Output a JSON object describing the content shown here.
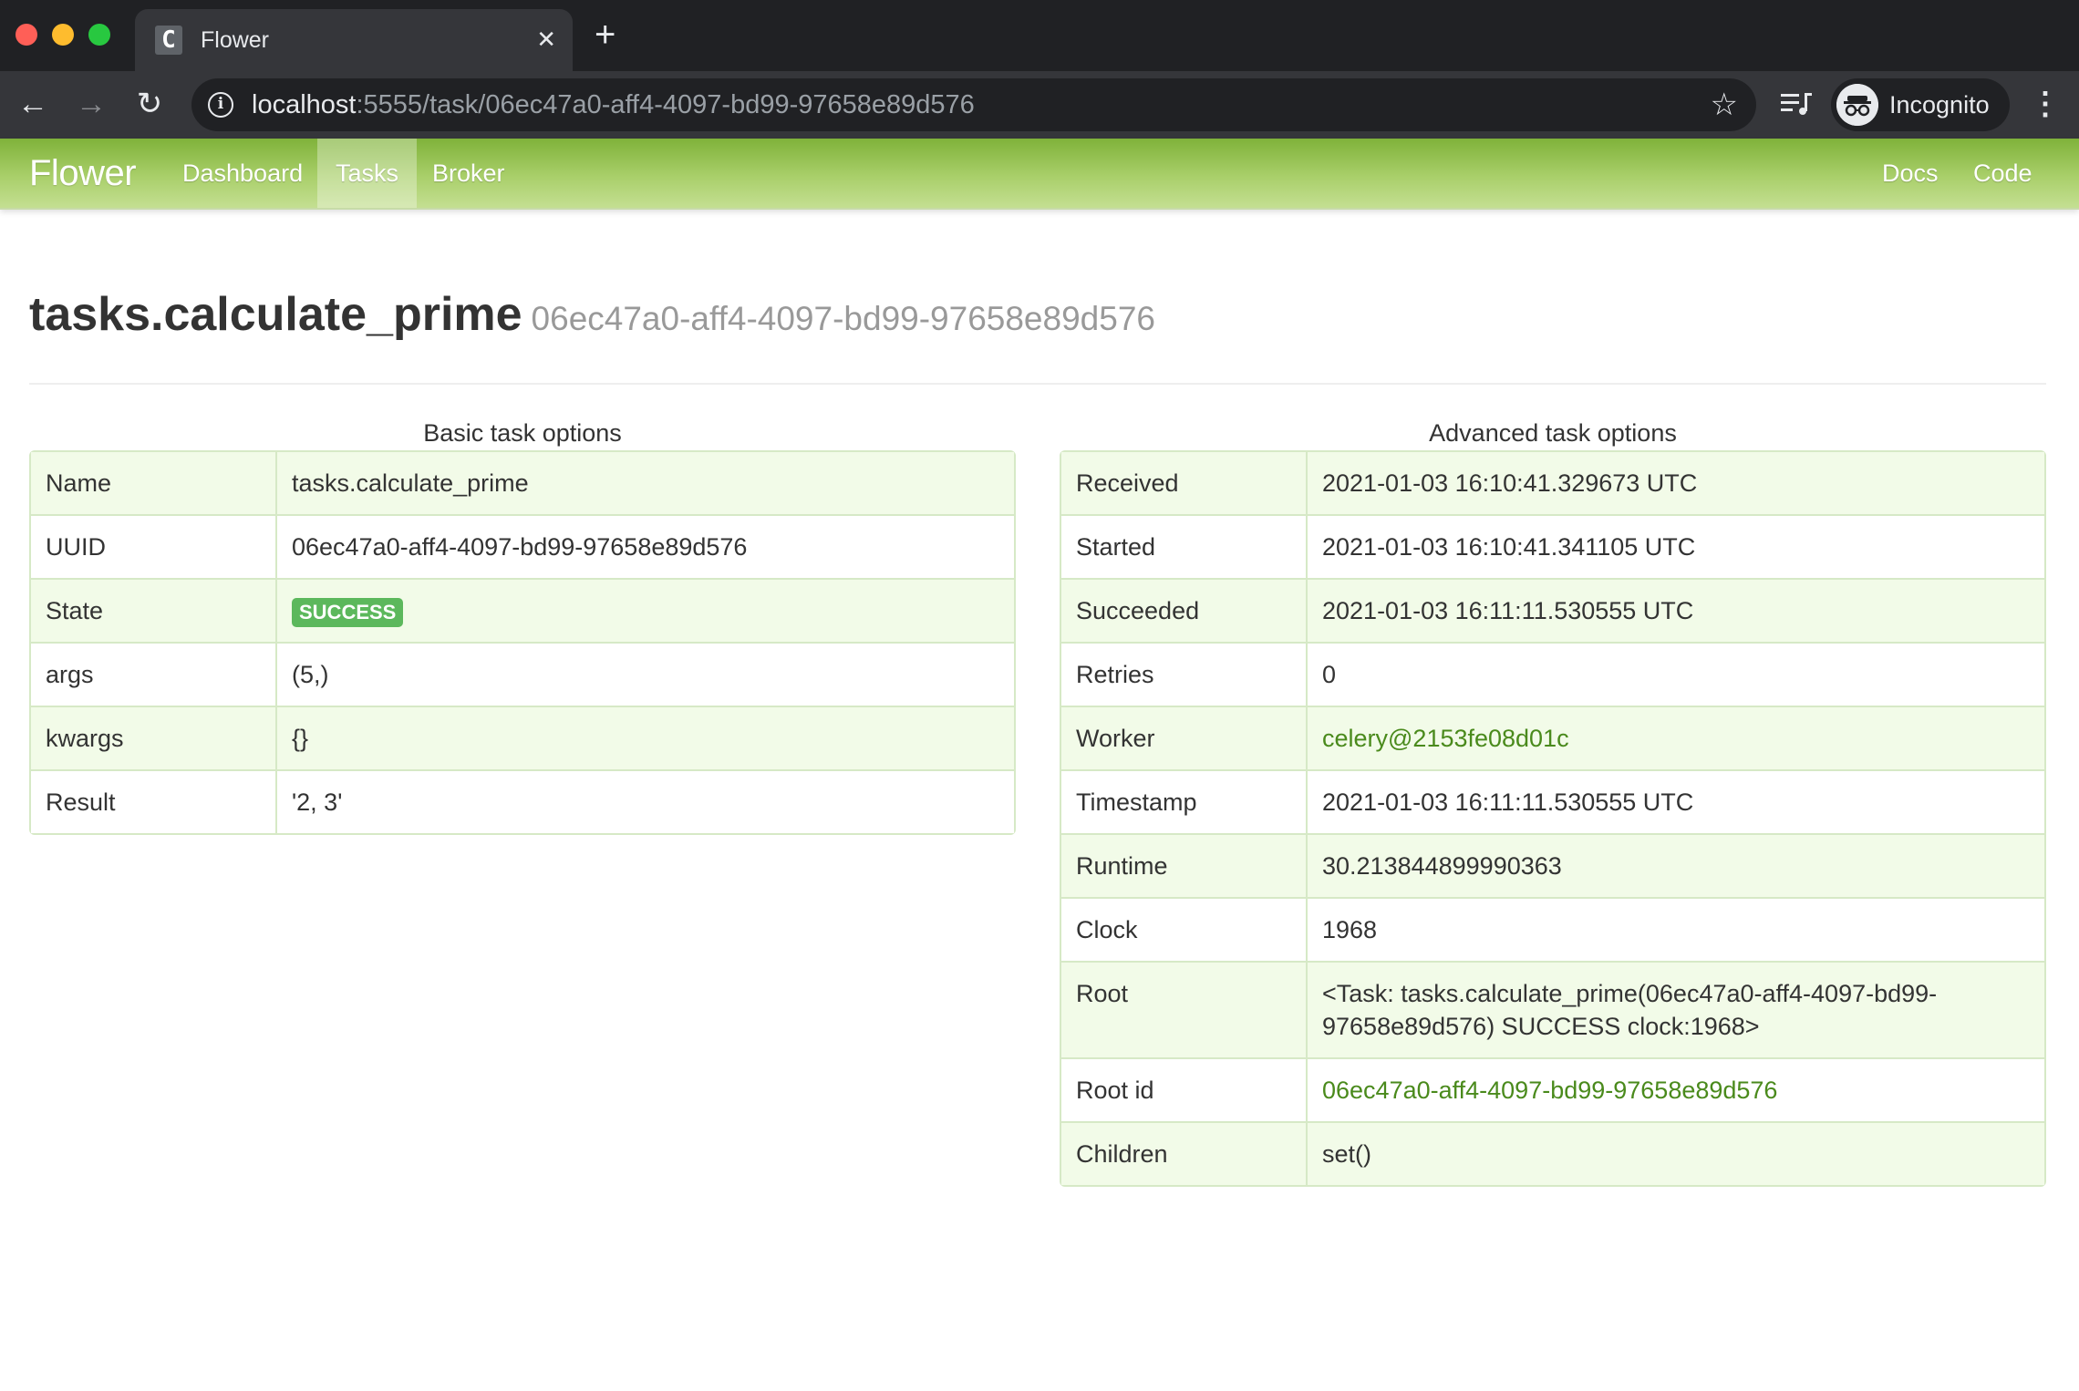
{
  "browser": {
    "tab_title": "Flower",
    "tab_favicon": "C",
    "url_host": "localhost",
    "url_rest": ":5555/task/06ec47a0-aff4-4097-bd99-97658e89d576",
    "profile_label": "Incognito",
    "icons": [
      "back-arrow-icon",
      "forward-arrow-icon",
      "reload-icon",
      "info-icon",
      "star-icon",
      "media-control-icon",
      "incognito-icon",
      "kebab-menu-icon",
      "close-icon",
      "plus-icon"
    ]
  },
  "navbar": {
    "brand": "Flower",
    "links": [
      "Dashboard",
      "Tasks",
      "Broker"
    ],
    "active": "Tasks",
    "right_links": [
      "Docs",
      "Code"
    ],
    "accent": "#8fbd4f"
  },
  "page": {
    "title": "tasks.calculate_prime",
    "subtitle": "06ec47a0-aff4-4097-bd99-97658e89d576"
  },
  "basic": {
    "caption": "Basic task options",
    "rows": [
      {
        "key": "Name",
        "value": "tasks.calculate_prime"
      },
      {
        "key": "UUID",
        "value": "06ec47a0-aff4-4097-bd99-97658e89d576"
      },
      {
        "key": "State",
        "value": "SUCCESS"
      },
      {
        "key": "args",
        "value": "(5,)"
      },
      {
        "key": "kwargs",
        "value": "{}"
      },
      {
        "key": "Result",
        "value": "'2, 3'"
      }
    ]
  },
  "advanced": {
    "caption": "Advanced task options",
    "rows": [
      {
        "key": "Received",
        "value": "2021-01-03 16:10:41.329673 UTC"
      },
      {
        "key": "Started",
        "value": "2021-01-03 16:10:41.341105 UTC"
      },
      {
        "key": "Succeeded",
        "value": "2021-01-03 16:11:11.530555 UTC"
      },
      {
        "key": "Retries",
        "value": "0"
      },
      {
        "key": "Worker",
        "value": "celery@2153fe08d01c"
      },
      {
        "key": "Timestamp",
        "value": "2021-01-03 16:11:11.530555 UTC"
      },
      {
        "key": "Runtime",
        "value": "30.213844899990363"
      },
      {
        "key": "Clock",
        "value": "1968"
      },
      {
        "key": "Root",
        "value": "<Task: tasks.calculate_prime(06ec47a0-aff4-4097-bd99-97658e89d576) SUCCESS clock:1968>"
      },
      {
        "key": "Root id",
        "value": "06ec47a0-aff4-4097-bd99-97658e89d576"
      },
      {
        "key": "Children",
        "value": "set()"
      }
    ]
  },
  "colors": {
    "success_badge": "#5cb85c",
    "link": "#4a8a1c",
    "row_stripe": "#f2fbe8",
    "table_border": "#d6e9c6"
  }
}
